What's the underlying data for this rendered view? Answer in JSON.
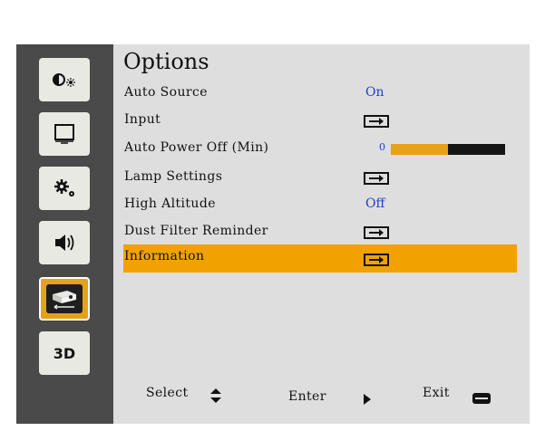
{
  "menu": {
    "title": "Options",
    "items": [
      {
        "label": "Auto Source",
        "value": "On"
      },
      {
        "label": "Input"
      },
      {
        "label": "Auto Power Off (Min)",
        "slider_value": "0",
        "slider_fill_fraction": 0.5
      },
      {
        "label": "Lamp Settings"
      },
      {
        "label": "High Altitude",
        "value": "Off"
      },
      {
        "label": "Dust Filter Reminder"
      },
      {
        "label": "Information",
        "selected": true
      }
    ]
  },
  "sidebar": {
    "items": [
      {
        "icon": "picture-icon"
      },
      {
        "icon": "display-icon"
      },
      {
        "icon": "settings-gear-icon"
      },
      {
        "icon": "volume-icon"
      },
      {
        "icon": "projector-options-icon",
        "selected": true
      },
      {
        "icon": "3d-icon",
        "text": "3D"
      }
    ]
  },
  "footer": {
    "select_label": "Select",
    "enter_label": "Enter",
    "exit_label": "Exit"
  },
  "colors": {
    "highlight": "#f2a200",
    "value_text": "#1a43c7",
    "panel": "#dedede",
    "frame": "#4a4a4a"
  }
}
